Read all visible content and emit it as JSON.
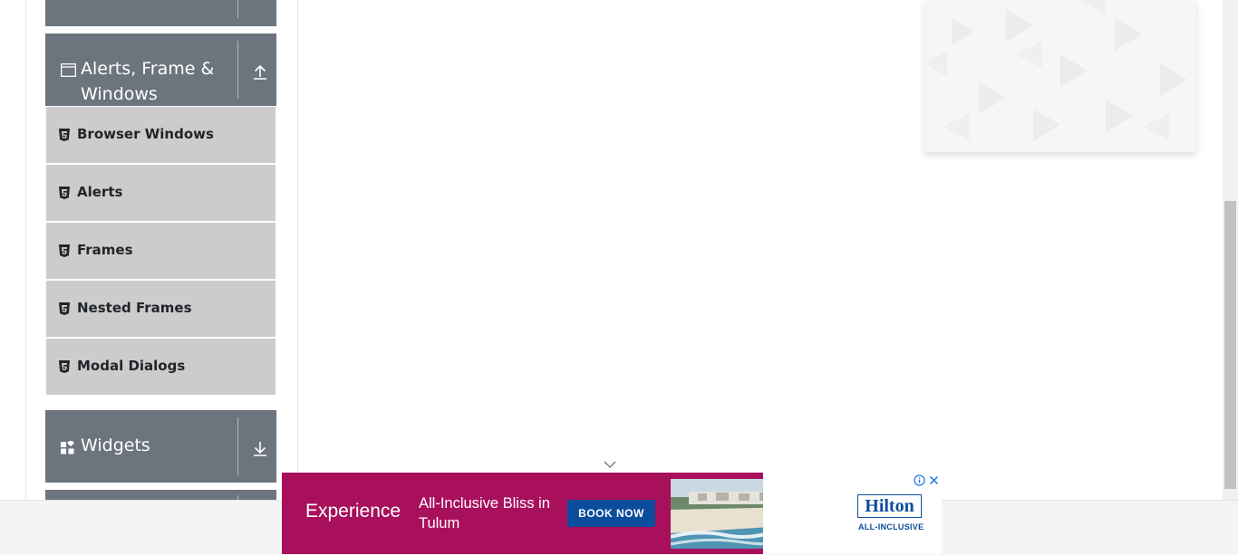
{
  "sidebar": {
    "groups": [
      {
        "title": "",
        "icon": "collapsed-group-icon",
        "action": "download-arrow-icon"
      },
      {
        "title_line1": "Alerts, Frame &",
        "title_line2": "Windows",
        "icon": "window-icon",
        "action": "upload-arrow-icon"
      },
      {
        "title": "Widgets",
        "icon": "widgets-icon",
        "action": "download-arrow-icon"
      }
    ],
    "items": [
      {
        "label": "Browser Windows",
        "icon": "html5-icon"
      },
      {
        "label": "Alerts",
        "icon": "html5-icon"
      },
      {
        "label": "Frames",
        "icon": "html5-icon"
      },
      {
        "label": "Nested Frames",
        "icon": "html5-icon"
      },
      {
        "label": "Modal Dialogs",
        "icon": "html5-icon"
      }
    ]
  },
  "ad": {
    "headline": "Experience",
    "subline": "All-Inclusive Bliss in Tulum",
    "cta": "BOOK NOW",
    "brand": "Hilton",
    "brand_sub": "ALL-INCLUSIVE",
    "background_color": "#a8105c",
    "cta_color": "#0b4d9c"
  },
  "colors": {
    "group_header_bg": "#6c757d",
    "menu_item_bg": "#cccccc",
    "text_dark": "#212529"
  }
}
